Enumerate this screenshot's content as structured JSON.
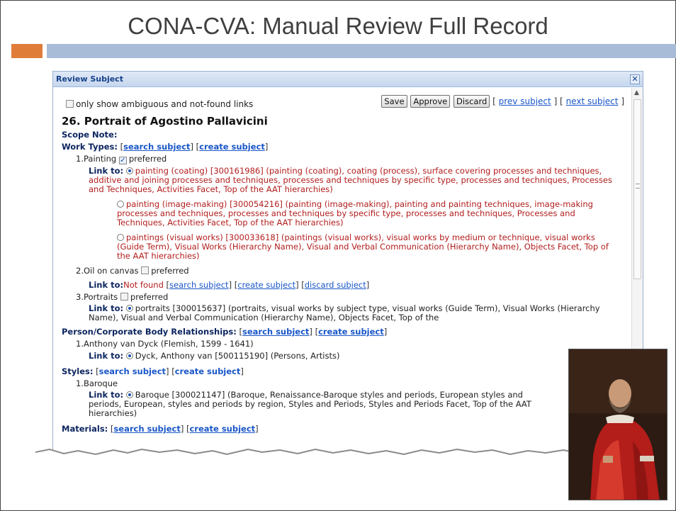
{
  "slide": {
    "title": "CONA-CVA: Manual Review Full Record",
    "accent_orange": "#e07c3a",
    "accent_blue": "#a9bcd7"
  },
  "dialog": {
    "title": "Review Subject",
    "close_icon": "close-icon",
    "filter_label": "only show ambiguous and not-found links",
    "buttons": {
      "save": "Save",
      "approve": "Approve",
      "discard": "Discard"
    },
    "nav": {
      "prev": "prev subject",
      "next": "next subject"
    }
  },
  "record": {
    "title": "26. Portrait of Agostino Pallavicini",
    "scope_note_label": "Scope Note:",
    "work_types_label": "Work Types:",
    "search_subject": "search subject",
    "create_subject": "create subject",
    "discard_subject": "discard subject",
    "preferred": "preferred",
    "link_to": "Link to:",
    "link_to_nf": "Link to:",
    "not_found": "Not found",
    "work_types": [
      {
        "label": "1.Painting",
        "options": [
          "painting (coating) [300161986] (painting (coating), coating (process), surface covering processes and techniques, additive and joining processes and techniques, processes and techniques by specific type, processes and techniques, Processes and Techniques, Activities Facet, Top of the AAT hierarchies)",
          "painting (image-making) [300054216] (painting (image-making), painting and painting techniques, image-making processes and techniques, processes and techniques by specific type, processes and techniques, Processes and Techniques, Activities Facet, Top of the AAT hierarchies)",
          "paintings (visual works) [300033618] (paintings (visual works), visual works by medium or technique, visual works (Guide Term), Visual Works (Hierarchy Name), Visual and Verbal Communication (Hierarchy Name), Objects Facet, Top of the AAT hierarchies)"
        ]
      },
      {
        "label": "2.Oil on canvas"
      },
      {
        "label": "3.Portraits",
        "option": "portraits [300015637] (portraits, visual works by subject type, visual works (Guide Term), Visual Works (Hierarchy Name), Visual and Verbal Communication (Hierarchy Name), Objects Facet, Top of the"
      }
    ],
    "person_label": "Person/Corporate Body Relationships:",
    "person": {
      "label": "1.Anthony van Dyck (Flemish, 1599 - 1641)",
      "option": "Dyck, Anthony van [500115190] (Persons, Artists)"
    },
    "styles_label": "Styles:",
    "style": {
      "label": "1.Baroque",
      "option": "Baroque [300021147] (Baroque, Renaissance-Baroque styles and periods, European styles and periods, European, styles and periods by region, Styles and Periods, Styles and Periods Facet, Top of the AAT hierarchies)"
    },
    "materials_label": "Materials:"
  }
}
